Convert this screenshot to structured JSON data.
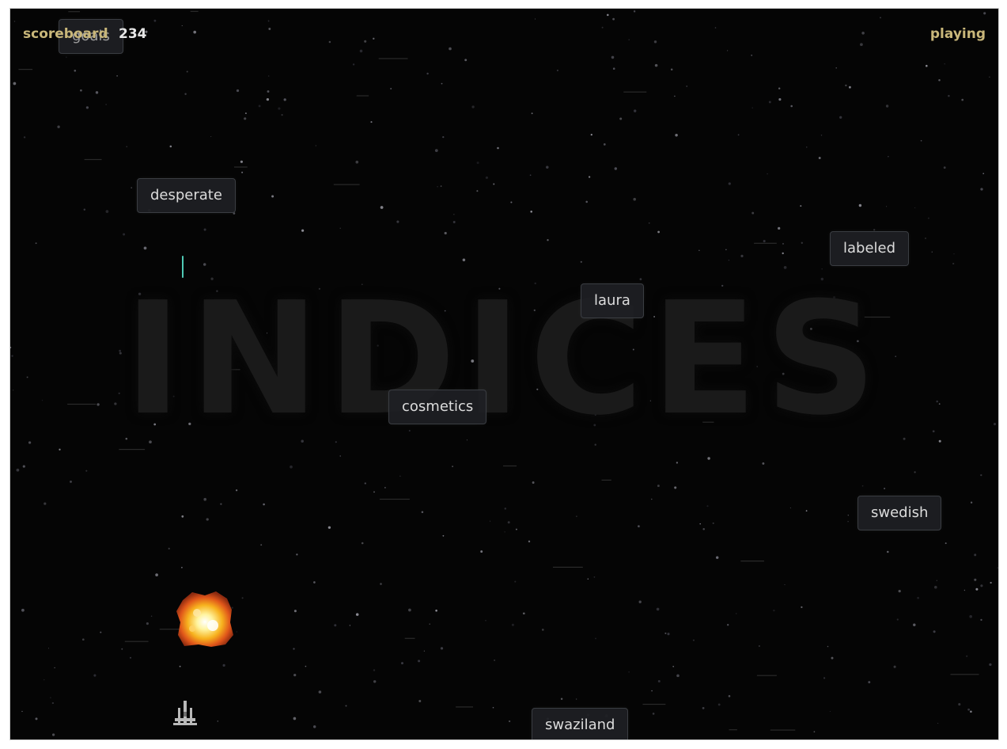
{
  "hud": {
    "score_label": "scoreboard",
    "score_value": "234",
    "status": "playing"
  },
  "background_word": "INDICES",
  "words": {
    "goals": "goals",
    "desperate": "desperate",
    "labeled": "labeled",
    "laura": "laura",
    "cosmetics": "cosmetics",
    "swedish": "swedish",
    "swaziland": "swaziland"
  },
  "colors": {
    "background": "#050505",
    "hud_label": "#c9b77a",
    "laser": "#4fc9b4"
  },
  "icons": {
    "player": "spaceship-icon",
    "explosion": "explosion-icon",
    "shot": "laser-shot"
  }
}
